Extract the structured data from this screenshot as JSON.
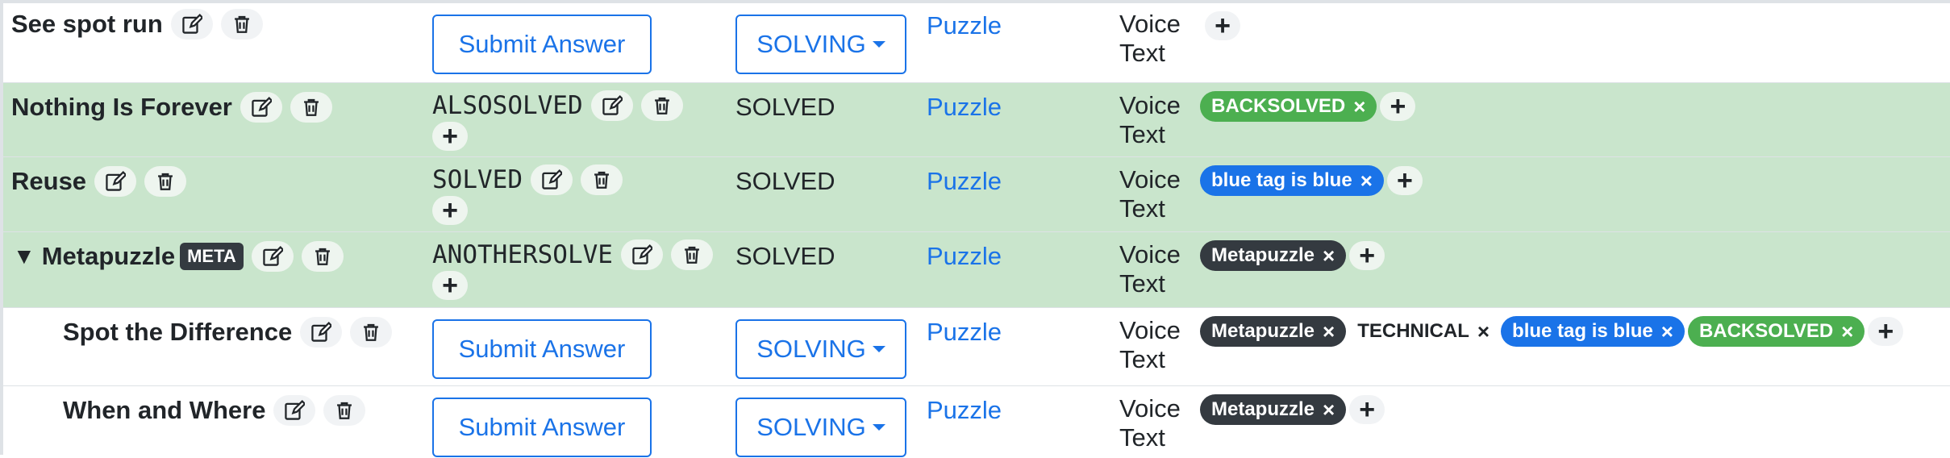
{
  "colors": {
    "solved_row": "#c9e5cc",
    "link": "#1a73e8",
    "tag_dark": "#343a40",
    "tag_green": "#4caf50",
    "tag_blue": "#1a73e8"
  },
  "discord": {
    "voice": "Voice",
    "text": "Text"
  },
  "labels": {
    "submit": "Submit Answer",
    "solving": "SOLVING",
    "puzzle_link": "Puzzle",
    "meta_badge": "META",
    "plus": "+",
    "tag_remove": "×"
  },
  "rows": [
    {
      "name": "See spot run",
      "solved": false,
      "answer": "",
      "status": "SOLVING",
      "tags": []
    },
    {
      "name": "Nothing Is Forever",
      "solved": true,
      "answer": "ALSOSOLVED",
      "status": "SOLVED",
      "tags": [
        {
          "label": "BACKSOLVED",
          "color": "green"
        }
      ]
    },
    {
      "name": "Reuse",
      "solved": true,
      "answer": "SOLVED",
      "status": "SOLVED",
      "tags": [
        {
          "label": "blue tag is blue",
          "color": "blue"
        }
      ]
    },
    {
      "name": "Metapuzzle",
      "solved": true,
      "is_meta": true,
      "answer": "ANOTHERSOLVE",
      "status": "SOLVED",
      "tags": [
        {
          "label": "Metapuzzle",
          "color": "dark"
        }
      ]
    },
    {
      "name": "Spot the Difference",
      "solved": false,
      "answer": "",
      "status": "SOLVING",
      "tags": [
        {
          "label": "Metapuzzle",
          "color": "dark"
        },
        {
          "label": "TECHNICAL",
          "color": "plain"
        },
        {
          "label": "blue tag is blue",
          "color": "blue"
        },
        {
          "label": "BACKSOLVED",
          "color": "green"
        }
      ]
    },
    {
      "name": "When and Where",
      "solved": false,
      "answer": "",
      "status": "SOLVING",
      "tags": [
        {
          "label": "Metapuzzle",
          "color": "dark"
        }
      ]
    }
  ]
}
